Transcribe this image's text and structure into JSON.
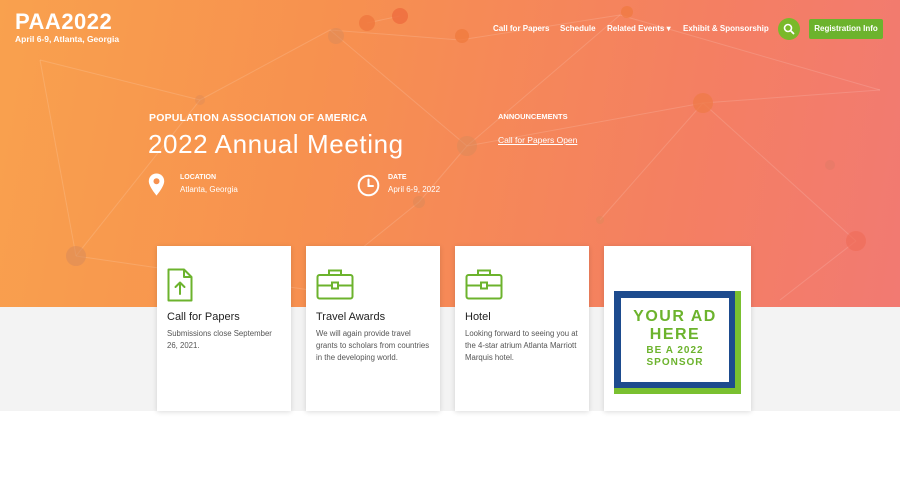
{
  "logo": {
    "text": "PAA2022",
    "subtitle": "April 6-9, Atlanta, Georgia"
  },
  "nav": {
    "items": [
      {
        "label": "Call for Papers"
      },
      {
        "label": "Schedule"
      },
      {
        "label": "Related Events ▾"
      },
      {
        "label": "Exhibit & Sponsorship"
      }
    ],
    "search_icon": "search-icon",
    "registration_label": "Registration Info"
  },
  "hero": {
    "org": "POPULATION ASSOCIATION OF AMERICA",
    "title": "2022 Annual Meeting",
    "location": {
      "label": "LOCATION",
      "value": "Atlanta, Georgia",
      "icon": "map-pin-icon"
    },
    "date": {
      "label": "DATE",
      "value": "April 6-9, 2022",
      "icon": "clock-icon"
    },
    "announcements": {
      "label": "ANNOUNCEMENTS",
      "link": "Call for Papers Open"
    }
  },
  "cards": [
    {
      "title": "Call for Papers",
      "body": "Submissions close September 26, 2021.",
      "icon": "upload-document-icon"
    },
    {
      "title": "Travel Awards",
      "body": "We will again provide travel grants to scholars from countries in the developing world.",
      "icon": "briefcase-icon"
    },
    {
      "title": "Hotel",
      "body": "Looking forward to seeing you at the 4-star atrium Atlanta Marriott Marquis hotel.",
      "icon": "briefcase-icon"
    }
  ],
  "ad": {
    "line1": "YOUR AD HERE",
    "line2": "BE A 2022 SPONSOR"
  },
  "colors": {
    "accent_green": "#6cb32d",
    "hero_orange": "#f7914f",
    "hero_coral": "#f27a72",
    "ad_blue": "#1d4b8e"
  }
}
